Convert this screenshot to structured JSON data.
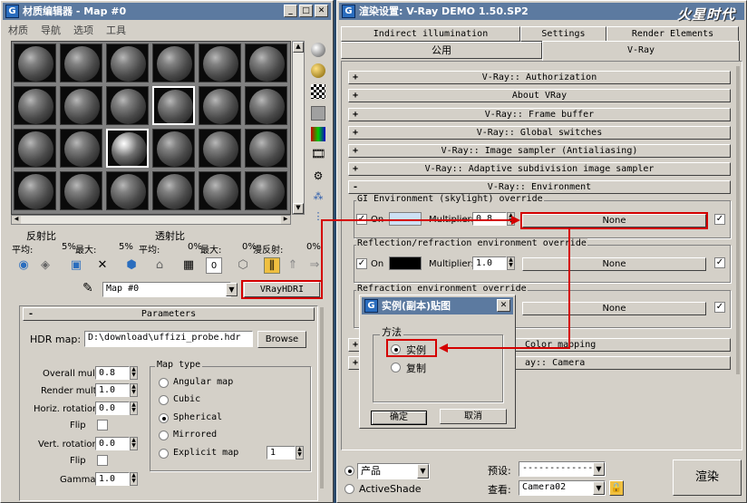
{
  "mat_editor": {
    "title": "材质编辑器 - Map #0",
    "menu": [
      "材质",
      "导航",
      "选项",
      "工具"
    ],
    "reflect_label": "反射比",
    "refract_label": "透射比",
    "avg1": "平均:",
    "avg1_val": "5%",
    "max1": "最大:",
    "max1_val": "5%",
    "avg2": "平均:",
    "avg2_val": "0%",
    "max2": "最大:",
    "max2_val": "0%",
    "diffuse": "漫反射:",
    "diffuse_val": "0%",
    "map_name": "Map #0",
    "map_type": "VRayHDRI",
    "params_title": "Parameters",
    "hdr_label": "HDR map:",
    "hdr_value": "D:\\download\\uffizi_probe.hdr",
    "browse": "Browse",
    "overall_label": "Overall mult:",
    "overall_val": "0.8",
    "render_label": "Render mult:",
    "render_val": "1.0",
    "horiz_label": "Horiz. rotation:",
    "horiz_val": "0.0",
    "flip1": "Flip",
    "vert_label": "Vert. rotation:",
    "vert_val": "0.0",
    "flip2": "Flip",
    "gamma_label": "Gamma:",
    "gamma_val": "1.0",
    "maptype_title": "Map type",
    "maptypes": [
      "Angular map",
      "Cubic",
      "Spherical",
      "Mirrored",
      "Explicit map"
    ],
    "maptype_selected": "Spherical",
    "explicit_val": "1"
  },
  "render_setup": {
    "title": "渲染设置: V-Ray DEMO 1.50.SP2",
    "watermark": "火星时代",
    "tabs_row1": [
      "Indirect illumination",
      "Settings",
      "Render Elements"
    ],
    "tabs_row2": [
      "公用",
      "V-Ray"
    ],
    "rollouts": [
      "V-Ray:: Authorization",
      "About VRay",
      "V-Ray:: Frame buffer",
      "V-Ray:: Global switches",
      "V-Ray:: Image sampler (Antialiasing)",
      "V-Ray:: Adaptive subdivision image sampler",
      "V-Ray:: Environment"
    ],
    "gi_title": "GI Environment (skylight) override",
    "on": "On",
    "multiplier": "Multiplier:",
    "gi_mult": "0.8",
    "none": "None",
    "refl_title": "Reflection/refraction environment override",
    "refl_mult": "1.0",
    "refr_title": "Refraction environment override",
    "color_mapping": "Color mapping",
    "camera": "ay:: Camera",
    "product": "产品",
    "activeshade": "ActiveShade",
    "preset_label": "预设:",
    "preset_val": "------------------",
    "view_label": "查看:",
    "view_val": "Camera02",
    "render_btn": "渲染"
  },
  "dialog": {
    "title": "实例(副本)贴图",
    "method": "方法",
    "instance": "实例",
    "copy": "复制",
    "ok": "确定",
    "cancel": "取消"
  },
  "colors": {
    "annotation_red": "#d40000",
    "title_blue": "#5c7aa0"
  }
}
